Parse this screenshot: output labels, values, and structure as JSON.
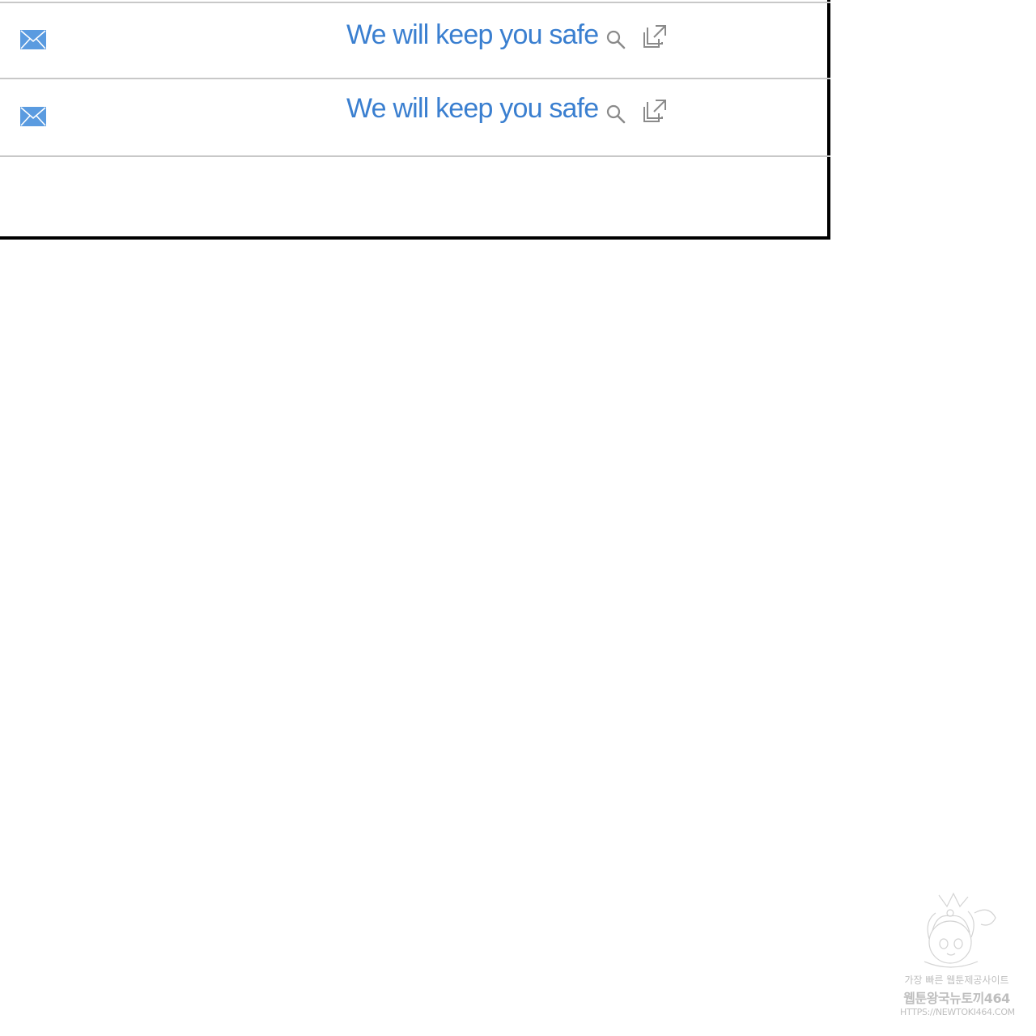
{
  "rows": [
    {
      "icon": "mail-icon",
      "title": "We will keep you safe",
      "actions": [
        "search-icon",
        "open-external-icon"
      ]
    },
    {
      "icon": "mail-icon",
      "title": "We will keep you safe",
      "actions": [
        "search-icon",
        "open-external-icon"
      ]
    }
  ],
  "colors": {
    "link": "#3a7fd0",
    "mail_icon": "#5a9be0",
    "action_icon": "#8a8a8a",
    "divider": "#c8c8c8",
    "frame": "#000000"
  },
  "watermark": {
    "line1": "가장 빠른 웹툰제공사이트",
    "line2": "웹툰왕국뉴토끼464",
    "line3": "HTTPS://NEWTOKI464.COM"
  }
}
